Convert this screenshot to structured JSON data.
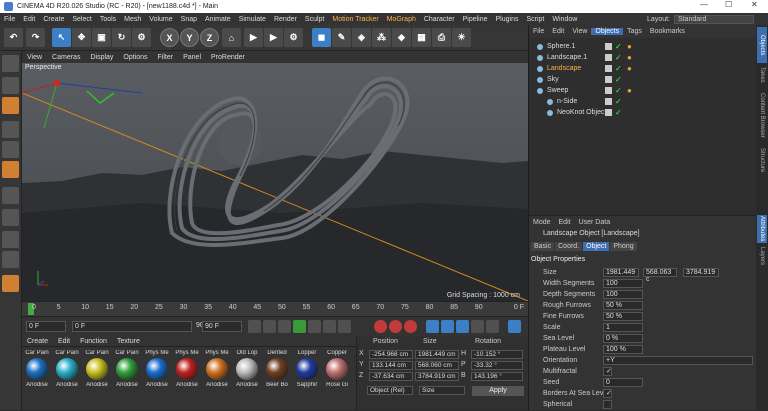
{
  "window": {
    "title": "CINEMA 4D R20.026 Studio (RC - R20) - [new1188.c4d *] - Main"
  },
  "menubar": {
    "items": [
      "File",
      "Edit",
      "Create",
      "Select",
      "Tools",
      "Mesh",
      "Volume",
      "Snap",
      "Animate",
      "Simulate",
      "Render",
      "Sculpt",
      "Motion Tracker",
      "MoGraph",
      "Character",
      "Pipeline",
      "Plugins",
      "Script",
      "Window"
    ],
    "highlight_color": "#ffb34a",
    "layout_label": "Layout:",
    "layout_value": "Standard"
  },
  "viewport": {
    "menu": [
      "View",
      "Cameras",
      "Display",
      "Options",
      "Filter",
      "Panel",
      "ProRender"
    ],
    "label": "Perspective",
    "grid_spacing": "Grid Spacing : 1000 cm"
  },
  "timeline": {
    "ticks": [
      "0",
      "5",
      "10",
      "15",
      "20",
      "25",
      "30",
      "35",
      "40",
      "45",
      "50",
      "55",
      "60",
      "65",
      "70",
      "75",
      "80",
      "85",
      "90"
    ],
    "end": "0 F"
  },
  "controls": {
    "current_frame": "0 F",
    "start_field": "0 F",
    "preview_end": "90 F",
    "end_frame": "90 F"
  },
  "materials": {
    "menu": [
      "Create",
      "Edit",
      "Function",
      "Texture"
    ],
    "items": [
      {
        "top": "Car Pain",
        "bottom": "Anodise",
        "color": "#1d6fc0"
      },
      {
        "top": "Car Pain",
        "bottom": "Anodise",
        "color": "#2ab0c8"
      },
      {
        "top": "Car Pain",
        "bottom": "Anodise",
        "color": "#c8c020"
      },
      {
        "top": "Car Pain",
        "bottom": "Anodise",
        "color": "#2ea03a"
      },
      {
        "top": "Phys Me",
        "bottom": "Anodise",
        "color": "#1a6cd0"
      },
      {
        "top": "Phys Me",
        "bottom": "Anodise",
        "color": "#c02020"
      },
      {
        "top": "Phys Me",
        "bottom": "Anodise",
        "color": "#d07020"
      },
      {
        "top": "Old Lop",
        "bottom": "Anodise",
        "color": "#bbbbbb"
      },
      {
        "top": "Dented",
        "bottom": "Beer Bo",
        "color": "#704020"
      },
      {
        "top": "Lopper",
        "bottom": "Sapphir",
        "color": "#203aa0"
      },
      {
        "top": "Copper",
        "bottom": "Rose Gi",
        "color": "#c07070"
      }
    ]
  },
  "coordinates": {
    "headers": [
      "Position",
      "Size",
      "Rotation"
    ],
    "rows": [
      {
        "axis": "X",
        "pos": "-254.968 cm",
        "size": "1981.449 cm",
        "rlabel": "H",
        "rot": "-10.152 °"
      },
      {
        "axis": "Y",
        "pos": "133.144 cm",
        "size": "568.060 cm",
        "rlabel": "P",
        "rot": "-33.32 °"
      },
      {
        "axis": "Z",
        "pos": "-37.634 cm",
        "size": "3784.919 cm",
        "rlabel": "B",
        "rot": "143.196 °"
      }
    ],
    "mode": "Object (Rel)",
    "size_mode": "Size",
    "apply": "Apply"
  },
  "objects": {
    "menu": [
      "File",
      "Edit",
      "View",
      "Objects",
      "Tags",
      "Bookmarks"
    ],
    "items": [
      {
        "name": "Sphere.1",
        "indent": 0,
        "color": "#ddd"
      },
      {
        "name": "Landscape.1",
        "indent": 0,
        "color": "#ddd"
      },
      {
        "name": "Landscape",
        "indent": 0,
        "color": "#ffb34a"
      },
      {
        "name": "Sky",
        "indent": 0,
        "color": "#ddd"
      },
      {
        "name": "Sweep",
        "indent": 0,
        "color": "#ddd"
      },
      {
        "name": "n-Side",
        "indent": 1,
        "color": "#ddd"
      },
      {
        "name": "NeoKnot Object",
        "indent": 1,
        "color": "#ddd"
      }
    ]
  },
  "attributes": {
    "menu": [
      "Mode",
      "Edit",
      "User Data"
    ],
    "title": "Landscape Object [Landscape]",
    "tabs": [
      "Basic",
      "Coord.",
      "Object",
      "Phong"
    ],
    "active_tab": "Object",
    "section": "Object Properties",
    "size_label": "Size",
    "size_values": [
      "1981.449",
      "568.063 c",
      "3784.919"
    ],
    "props": [
      {
        "label": "Width Segments",
        "value": "100"
      },
      {
        "label": "Depth Segments",
        "value": "100"
      },
      {
        "label": "Rough Furrows",
        "value": "50 %"
      },
      {
        "label": "Fine Furrows",
        "value": "50 %"
      },
      {
        "label": "Scale",
        "value": "1"
      },
      {
        "label": "Sea Level",
        "value": "0 %"
      },
      {
        "label": "Plateau Level",
        "value": "100 %"
      },
      {
        "label": "Orientation",
        "value": "+Y"
      },
      {
        "label": "Multifractal",
        "value": "✓"
      },
      {
        "label": "Seed",
        "value": "0"
      },
      {
        "label": "Borders At Sea Level",
        "value": "✓"
      },
      {
        "label": "Spherical",
        "value": ""
      }
    ]
  },
  "sidetabs": [
    "Objects",
    "Takes",
    "Content Browser",
    "Structure",
    "Attributes",
    "Layers"
  ]
}
